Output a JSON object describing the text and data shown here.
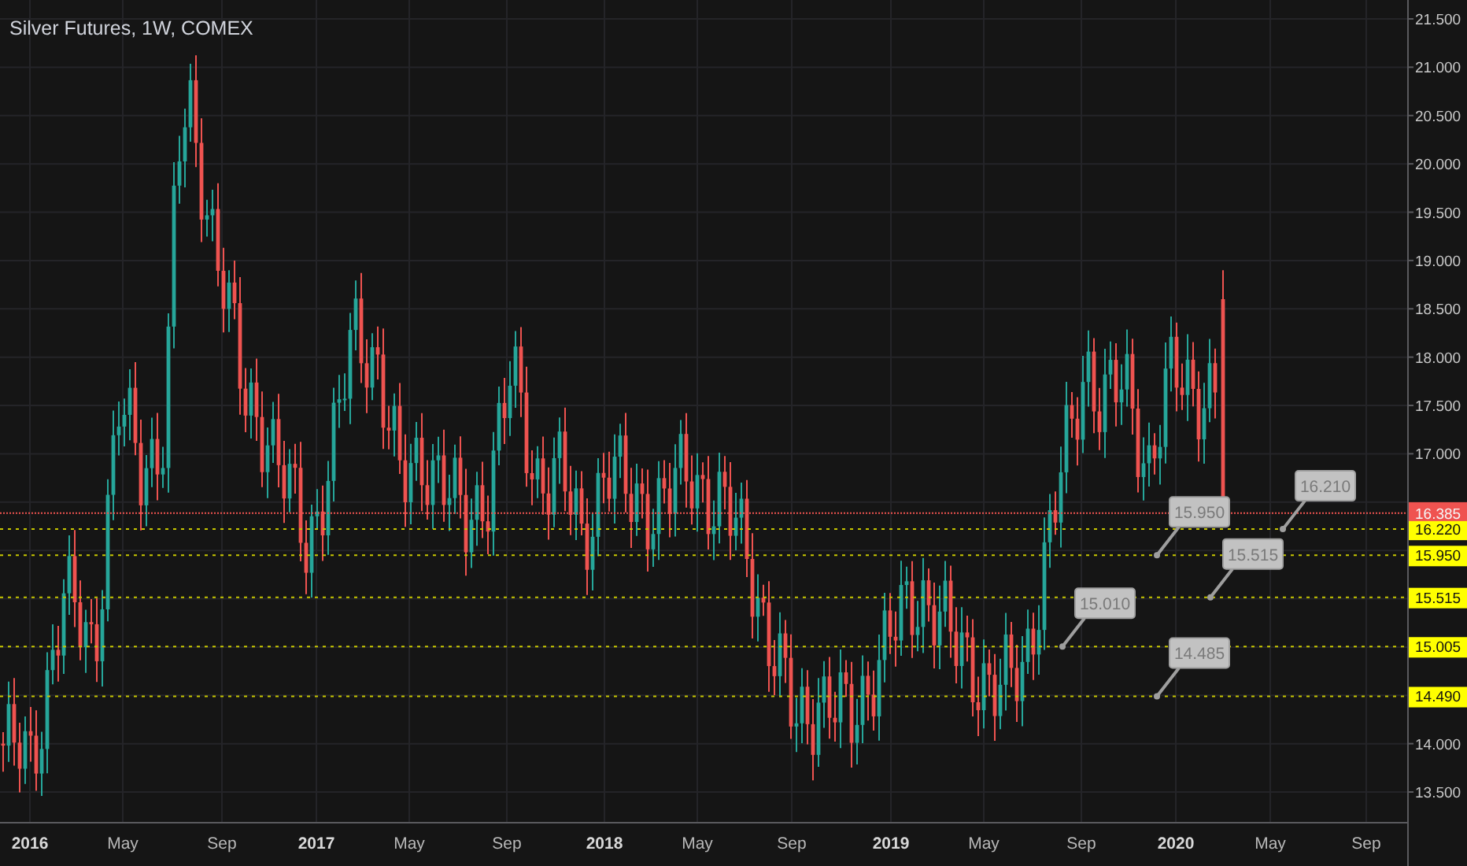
{
  "title": "Silver Futures, 1W, COMEX",
  "price_axis": {
    "ticks": [
      "21.500",
      "21.000",
      "20.500",
      "20.000",
      "19.500",
      "19.000",
      "18.500",
      "18.000",
      "17.500",
      "17.000",
      "14.000",
      "13.500"
    ]
  },
  "time_axis": {
    "ticks": [
      {
        "label": "2016",
        "kind": "year"
      },
      {
        "label": "May",
        "kind": "month"
      },
      {
        "label": "Sep",
        "kind": "month"
      },
      {
        "label": "2017",
        "kind": "year"
      },
      {
        "label": "May",
        "kind": "month"
      },
      {
        "label": "Sep",
        "kind": "month"
      },
      {
        "label": "2018",
        "kind": "year"
      },
      {
        "label": "May",
        "kind": "month"
      },
      {
        "label": "Sep",
        "kind": "month"
      },
      {
        "label": "2019",
        "kind": "year"
      },
      {
        "label": "May",
        "kind": "month"
      },
      {
        "label": "Sep",
        "kind": "month"
      },
      {
        "label": "2020",
        "kind": "year"
      },
      {
        "label": "May",
        "kind": "month"
      },
      {
        "label": "Sep",
        "kind": "month"
      }
    ]
  },
  "last_price": {
    "value": "16.385"
  },
  "price_lines": [
    {
      "value": "16.220",
      "callout": "16.210"
    },
    {
      "value": "15.950",
      "callout": "15.950"
    },
    {
      "value": "15.515",
      "callout": "15.515"
    },
    {
      "value": "15.005",
      "callout": "15.010"
    },
    {
      "value": "14.490",
      "callout": "14.485"
    }
  ]
}
